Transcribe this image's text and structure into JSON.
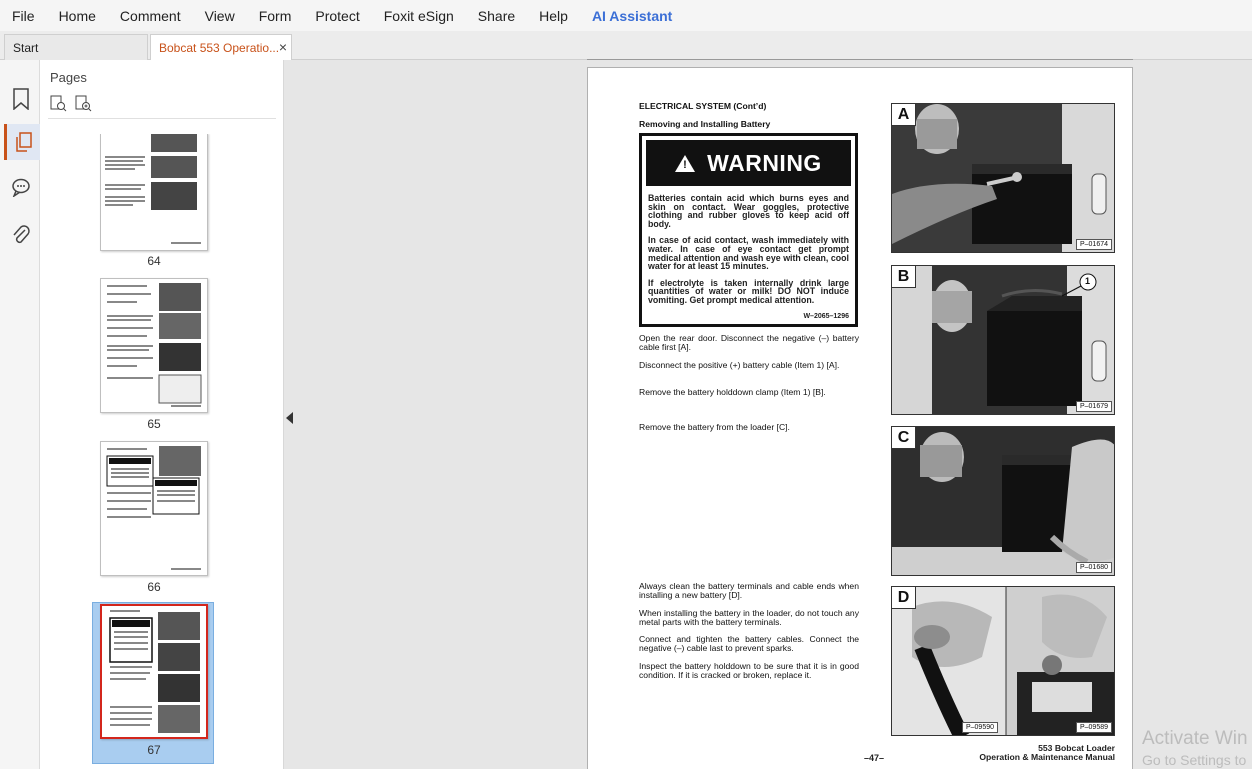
{
  "menu": {
    "items": [
      "File",
      "Home",
      "Comment",
      "View",
      "Form",
      "Protect",
      "Foxit eSign",
      "Share",
      "Help"
    ],
    "ai_assistant": "AI Assistant"
  },
  "tabs": {
    "start": "Start",
    "doc": "Bobcat 553 Operatio...",
    "close": "×"
  },
  "rail": {
    "icons": [
      "bookmark-icon",
      "pages-icon",
      "comment-icon",
      "attachment-icon"
    ]
  },
  "panel": {
    "title": "Pages",
    "thumbnails": [
      {
        "label": "64"
      },
      {
        "label": "65"
      },
      {
        "label": "66"
      },
      {
        "label": "67",
        "selected": true
      }
    ]
  },
  "page": {
    "heading1": "ELECTRICAL SYSTEM (Cont’d)",
    "heading2": "Removing and Installing Battery",
    "warning_title": "WARNING",
    "warning_p1": "Batteries contain acid which burns eyes and skin on contact. Wear goggles, protective clothing and rubber gloves to keep acid off body.",
    "warning_p2": "In case of acid contact, wash immediately with water. In case of eye contact get prompt medical attention and wash eye with clean, cool water for at least 15 minutes.",
    "warning_p3": "If electrolyte is taken internally drink large quantities of water or milk! DO NOT induce vomiting. Get prompt medical attention.",
    "warning_code": "W–2065–1296",
    "step1": "Open the rear door. Disconnect the negative (–) battery cable first [A].",
    "step2": "Disconnect the positive (+) battery cable (Item 1) [A].",
    "step3": "Remove the battery holddown clamp (Item 1) [B].",
    "step4": "Remove the battery from the loader [C].",
    "step5": "Always clean the battery terminals and cable ends when installing a new battery [D].",
    "step6": "When installing the battery in the loader, do not touch any metal parts with the battery terminals.",
    "step7": "Connect and tighten the battery cables. Connect the negative (–) cable last to prevent sparks.",
    "step8": "Inspect the battery holddown to be sure that it is in good condition. If it is cracked or broken, replace it.",
    "photos": [
      {
        "letter": "A",
        "code": "P–01674"
      },
      {
        "letter": "B",
        "code": "P–01679",
        "callout": "1"
      },
      {
        "letter": "C",
        "code": "P–01680"
      },
      {
        "letter": "D",
        "code": "P–09589",
        "code2": "P–09590"
      }
    ],
    "page_number": "–47–",
    "footer_line1": "553 Bobcat Loader",
    "footer_line2": "Operation & Maintenance Manual"
  },
  "watermark": {
    "line1": "Activate Win",
    "line2": "Go to Settings to"
  }
}
